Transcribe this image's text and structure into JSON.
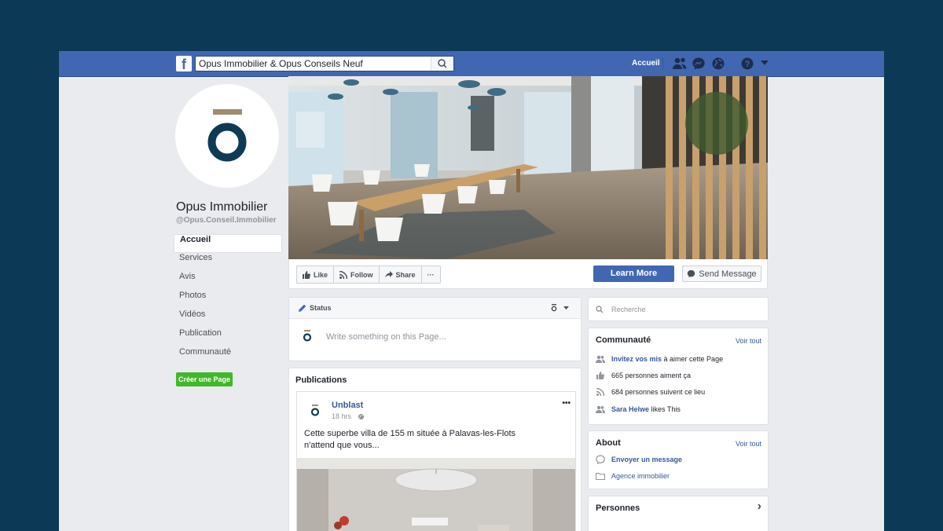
{
  "topbar": {
    "search_value": "Opus Immobilier & Opus Conseils Neuf",
    "home_label": "Accueil",
    "icons": [
      "friends-icon",
      "messenger-icon",
      "globe-icon",
      "help-icon",
      "caret-down-icon"
    ]
  },
  "profile": {
    "name": "Opus Immobilier",
    "handle": "@Opus.Conseil.Immobilier"
  },
  "nav": {
    "items": [
      {
        "label": "Accueil",
        "active": true
      },
      {
        "label": "Services"
      },
      {
        "label": "Avis"
      },
      {
        "label": "Photos"
      },
      {
        "label": "Vidéos"
      },
      {
        "label": "Publication"
      },
      {
        "label": "Communauté"
      }
    ]
  },
  "create_page_label": "Créer une Page",
  "actions": {
    "like": "Like",
    "follow": "Follow",
    "share": "Share",
    "more": "···",
    "learn_more": "Learn More",
    "send_message": "Send Message"
  },
  "status": {
    "label": "Status",
    "placeholder": "Write something on this Page..."
  },
  "publications": {
    "title": "Publications",
    "post": {
      "author": "Unblast",
      "time": "18 hrs",
      "text_line1": "Cette superbe villa de 155 m  située à Palavas-les-Flots",
      "text_line2": "n'attend que vous...",
      "more": "•••"
    }
  },
  "sidebar": {
    "search_placeholder": "Recherche",
    "community": {
      "title": "Communauté",
      "see_all": "Voir tout",
      "invite_link": "Invitez vos mis",
      "invite_rest": " à aimer cette Page",
      "likes": "665 personnes aiment ça",
      "follows": "684 personnes suivent ce lieu",
      "friend_name": "Sara Helwe",
      "friend_rest": " likes This"
    },
    "about": {
      "title": "About",
      "see_all": "Voir tout",
      "send_message": "Envoyer un message",
      "category": "Agence immobilier"
    },
    "people": {
      "title": "Personnes",
      "chevron": "›"
    }
  },
  "colors": {
    "fb_blue": "#4267b2",
    "brand_navy": "#0e3a55",
    "brand_tan": "#a08c70",
    "create_green": "#42b72a"
  }
}
